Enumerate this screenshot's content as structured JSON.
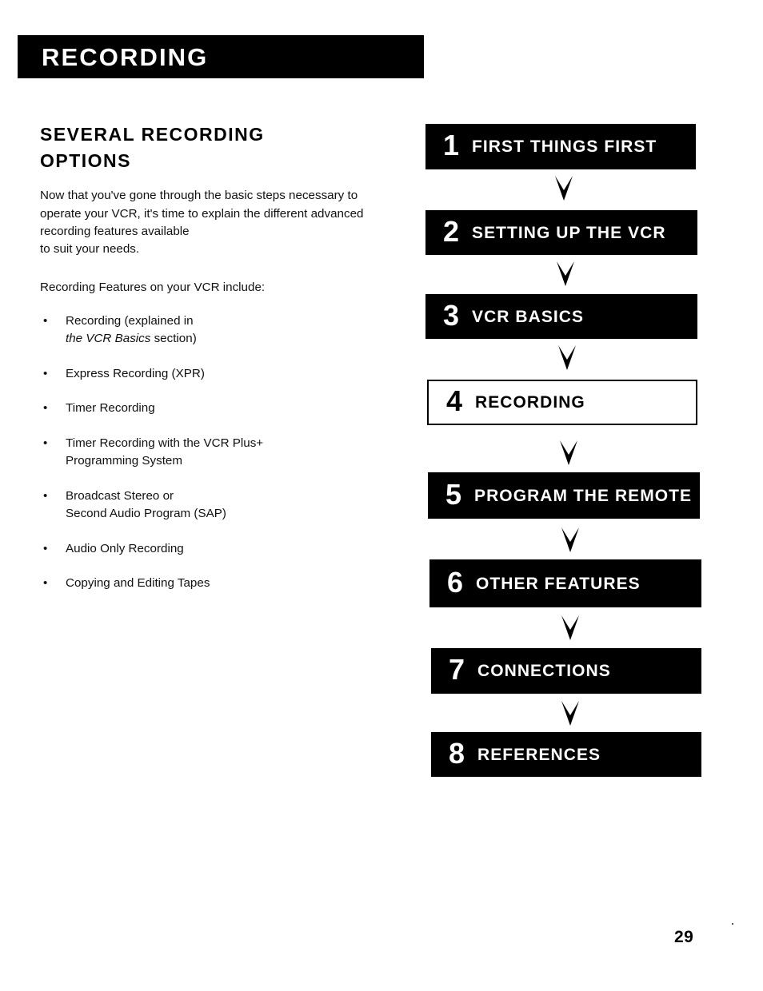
{
  "document": {
    "section_banner_title": "RECORDING",
    "page_number": "29"
  },
  "left_column": {
    "heading_line1": "SEVERAL RECORDING",
    "heading_line2": "OPTIONS",
    "intro_lines": [
      "Now that you've gone through the basic steps necessary to",
      "operate your VCR, it's time to explain the different advanced",
      "recording features available",
      "to suit your needs."
    ],
    "list_lead": "Recording Features on your VCR include:",
    "bullet_marker": "•",
    "features": [
      {
        "line1": "Recording (explained in",
        "line2_italic": "the VCR Basics",
        "line2_rest": " section)"
      },
      {
        "line1": "Express Recording (XPR)",
        "line2_italic": "",
        "line2_rest": ""
      },
      {
        "line1": "Timer Recording",
        "line2_italic": "",
        "line2_rest": ""
      },
      {
        "line1": "Timer Recording with the VCR Plus+",
        "line2_italic": "",
        "line2_rest": "Programming System"
      },
      {
        "line1": "Broadcast Stereo or",
        "line2_italic": "",
        "line2_rest": "Second Audio Program (SAP)"
      },
      {
        "line1": "Audio Only Recording",
        "line2_italic": "",
        "line2_rest": ""
      },
      {
        "line1": "Copying and Editing Tapes",
        "line2_italic": "",
        "line2_rest": ""
      }
    ]
  },
  "flowchart": {
    "arrow_icon": "chevron-down-arrow",
    "steps": [
      {
        "number": "1",
        "label": "FIRST THINGS FIRST",
        "current": false
      },
      {
        "number": "2",
        "label": "SETTING UP THE VCR",
        "current": false
      },
      {
        "number": "3",
        "label": "VCR BASICS",
        "current": false
      },
      {
        "number": "4",
        "label": "RECORDING",
        "current": true
      },
      {
        "number": "5",
        "label": "PROGRAM THE REMOTE",
        "current": false
      },
      {
        "number": "6",
        "label": "OTHER FEATURES",
        "current": false
      },
      {
        "number": "7",
        "label": "CONNECTIONS",
        "current": false
      },
      {
        "number": "8",
        "label": "REFERENCES",
        "current": false
      }
    ]
  },
  "colors": {
    "ink": "#000000",
    "paper": "#ffffff",
    "banner_text": "#ffffff"
  }
}
